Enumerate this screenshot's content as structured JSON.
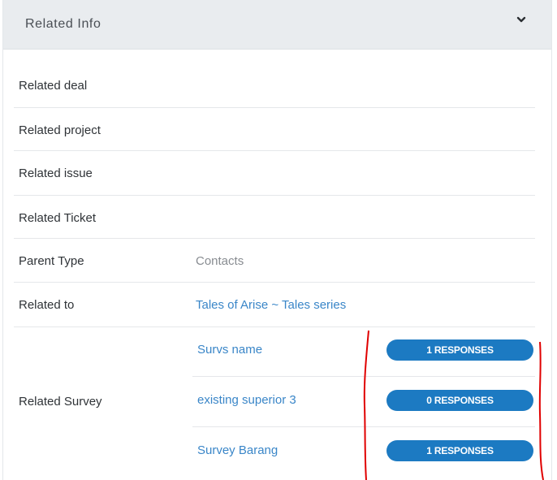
{
  "panel": {
    "title": "Related Info",
    "toggle_icon": "chevron-down-icon"
  },
  "fields": {
    "related_deal": {
      "label": "Related deal",
      "value": ""
    },
    "related_project": {
      "label": "Related project",
      "value": ""
    },
    "related_issue": {
      "label": "Related issue",
      "value": ""
    },
    "related_ticket": {
      "label": "Related Ticket",
      "value": ""
    },
    "parent_type": {
      "label": "Parent Type",
      "value": "Contacts"
    },
    "related_to": {
      "label": "Related to",
      "value": "Tales of Arise ~ Tales series"
    }
  },
  "related_survey": {
    "label": "Related Survey",
    "items": [
      {
        "name": "Survs name",
        "responses": "1 RESPONSES"
      },
      {
        "name": "existing superior 3",
        "responses": "0 RESPONSES"
      },
      {
        "name": "Survey Barang",
        "responses": "1 RESPONSES"
      }
    ]
  },
  "colors": {
    "header_bg": "#e9ecef",
    "link": "#3a86c8",
    "badge": "#1c7ac2",
    "annotation": "#e00000"
  }
}
